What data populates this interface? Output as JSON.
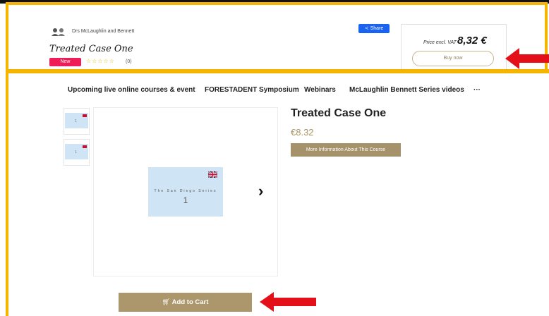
{
  "header": {
    "authors": "Drs McLaughlin and Bennett",
    "title": "Treated Case One",
    "badge": "New",
    "rating_count": "(0)",
    "share_label": "Share",
    "price_label": "Price excl. VAT",
    "price_value": "8,32 €",
    "buy_label": "Buy now"
  },
  "nav": {
    "items": [
      "Upcoming live online courses & event",
      "FORESTADENT Symposium",
      "Webinars",
      "McLaughlin Bennett Series videos",
      "···"
    ]
  },
  "product": {
    "title": "Treated Case One",
    "price": "€8.32",
    "more_info_label": "More Information About This Course",
    "add_to_cart_label": "Add to Cart",
    "slide_caption": "The San Diego Series",
    "slide_number": "1"
  },
  "thumbnails": [
    {
      "number": "1"
    },
    {
      "number": "1"
    }
  ],
  "colors": {
    "highlight": "#f5b400",
    "arrow": "#e3101a",
    "accent": "#a5916a",
    "badge": "#ee1c57",
    "share": "#1a62f0"
  }
}
